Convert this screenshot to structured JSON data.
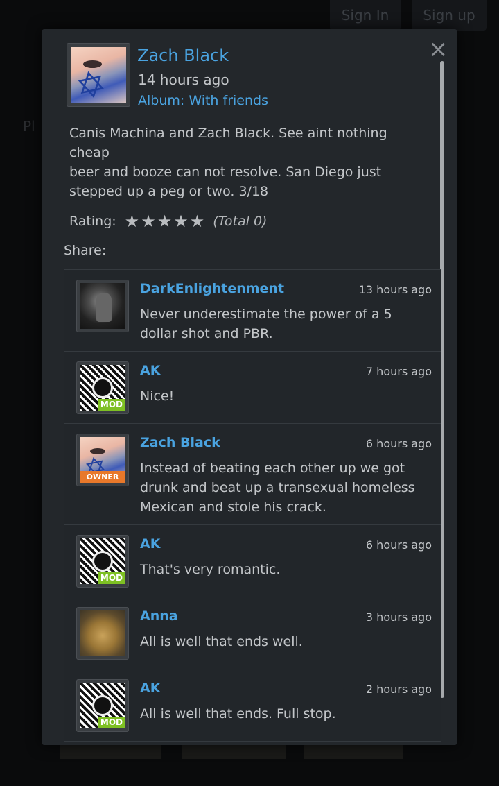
{
  "header": {
    "sign_in": "Sign In",
    "sign_up": "Sign up"
  },
  "background": {
    "partial_text": "Pl"
  },
  "post": {
    "author": "Zach Black",
    "time": "14 hours ago",
    "album": "Album: With friends",
    "caption_lines": [
      "Canis Machina and Zach Black. See aint nothing cheap",
      "beer and booze can not resolve. San Diego just stepped up a peg or two. 3/18"
    ],
    "rating_label": "Rating:",
    "rating_value": 0,
    "rating_max": 5,
    "rating_total": "(Total 0)",
    "share_label": "Share:"
  },
  "close_icon": "close-icon",
  "comments": [
    {
      "author": "DarkEnlightenment",
      "time": "13 hours ago",
      "text": "Never underestimate the power of a 5 dollar shot and PBR.",
      "badge": "",
      "avatar": "dark-figure"
    },
    {
      "author": "AK",
      "time": "7 hours ago",
      "text": "Nice!",
      "badge": "MOD",
      "avatar": "pattern"
    },
    {
      "author": "Zach Black",
      "time": "6 hours ago",
      "text": "Instead of beating each other up we got drunk and beat up a transexual homeless Mexican and stole his crack.",
      "badge": "OWNER",
      "avatar": "zach"
    },
    {
      "author": "AK",
      "time": "6 hours ago",
      "text": "That's very romantic.",
      "badge": "MOD",
      "avatar": "pattern"
    },
    {
      "author": "Anna",
      "time": "3 hours ago",
      "text": "All is well that ends well.",
      "badge": "",
      "avatar": "cat"
    },
    {
      "author": "AK",
      "time": "2 hours ago",
      "text": "All is well that ends. Full stop.",
      "badge": "MOD",
      "avatar": "pattern"
    }
  ],
  "colors": {
    "link": "#4aa3e0",
    "mod_badge": "#7ec023",
    "owner_badge": "#e8782a",
    "modal_bg": "#23272b"
  }
}
